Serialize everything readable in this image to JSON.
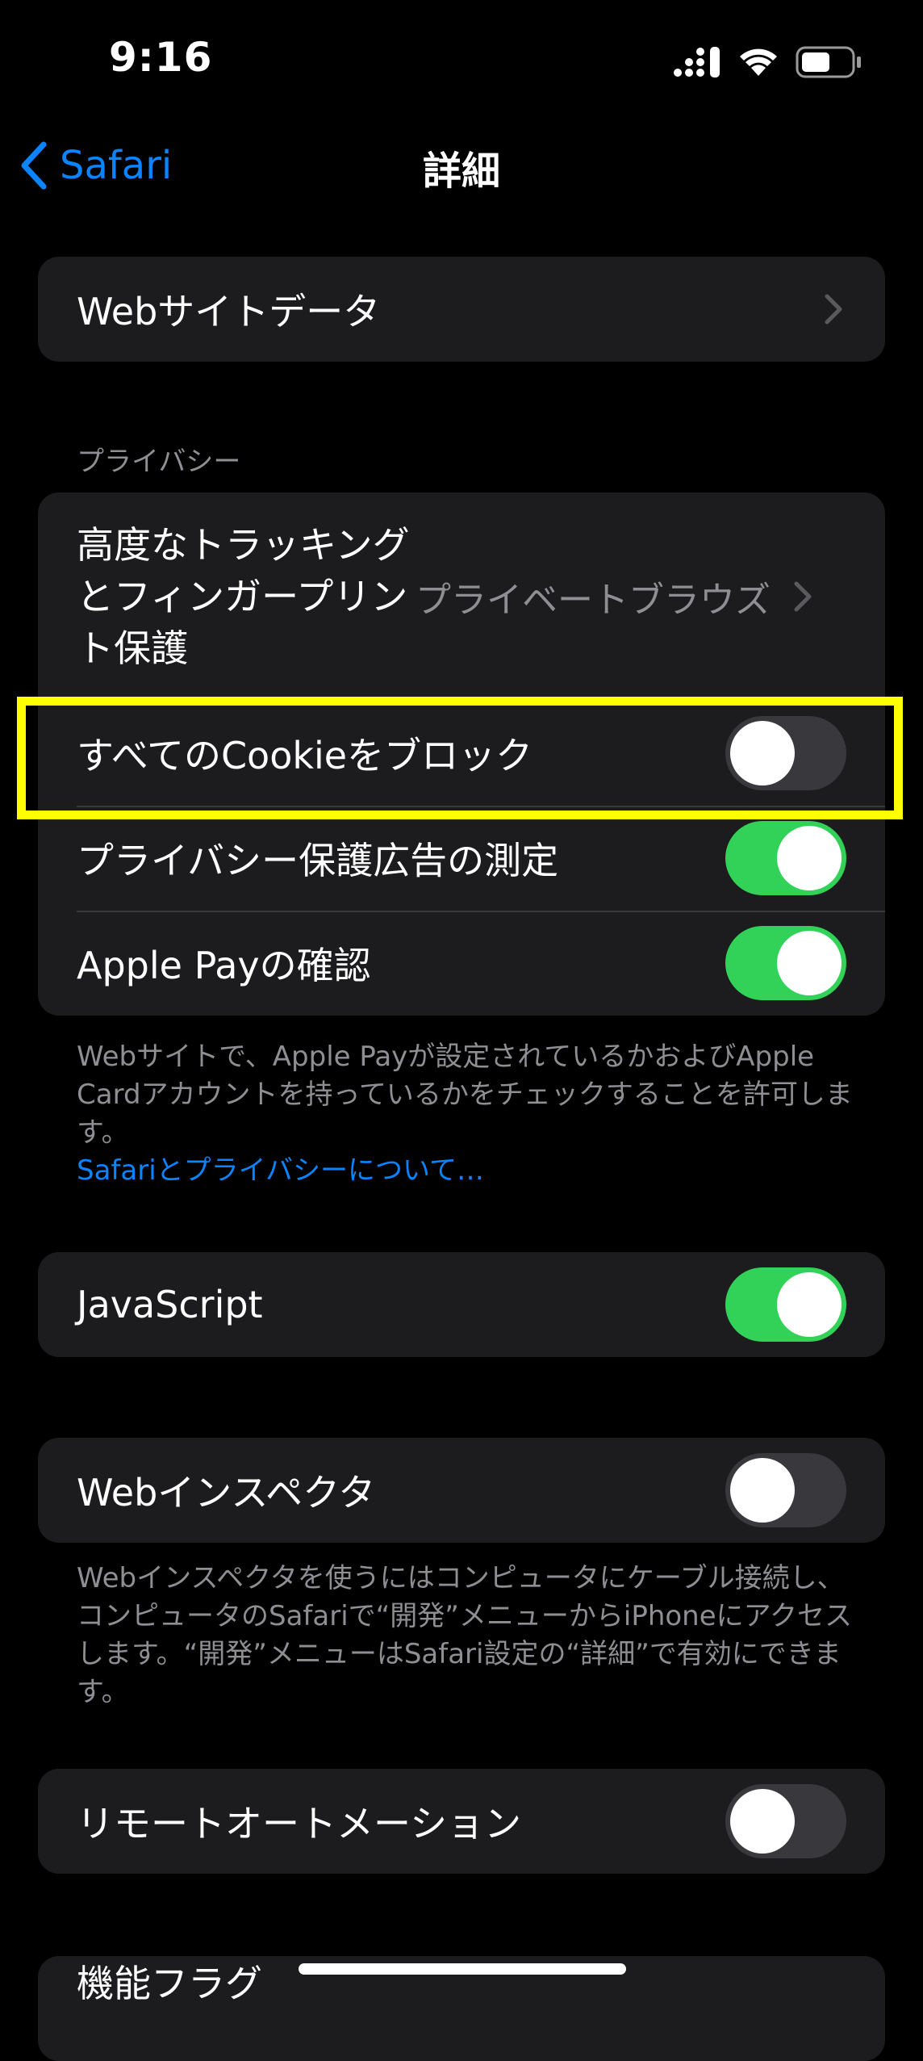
{
  "status_bar": {
    "time": "9:16",
    "icons": [
      "cellular-signal-icon",
      "wifi-icon",
      "battery-icon"
    ]
  },
  "nav": {
    "back_label": "Safari",
    "title": "詳細"
  },
  "website_data": {
    "label": "Webサイトデータ"
  },
  "privacy": {
    "header": "プライバシー",
    "tracking": {
      "label": "高度なトラッキングとフィンガープリント保護",
      "value": "プライベートブラウズ"
    },
    "block_cookies": {
      "label": "すべてのCookieをブロック",
      "on": false
    },
    "ad_measurement": {
      "label": "プライバシー保護広告の測定",
      "on": true
    },
    "apple_pay": {
      "label": "Apple Payの確認",
      "on": true
    },
    "footer": "Webサイトで、Apple Payが設定されているかおよびApple Cardアカウントを持っているかをチェックすることを許可します。",
    "footer_link": "Safariとプライバシーについて…"
  },
  "javascript": {
    "label": "JavaScript",
    "on": true
  },
  "web_inspector": {
    "label": "Webインスペクタ",
    "on": false,
    "footer": "Webインスペクタを使うにはコンピュータにケーブル接続し、コンピュータのSafariで“開発”メニューからiPhoneにアクセスします。“開発”メニューはSafari設定の“詳細”で有効にできます。"
  },
  "remote_automation": {
    "label": "リモートオートメーション",
    "on": false
  },
  "feature_flags": {
    "label": "機能フラグ"
  },
  "colors": {
    "accent": "#0a84ff",
    "toggle_on": "#32d158",
    "toggle_off": "#39393d",
    "cell_background": "#1c1c1e",
    "secondary_text": "#8e8e93",
    "highlight": "#ffff00"
  }
}
